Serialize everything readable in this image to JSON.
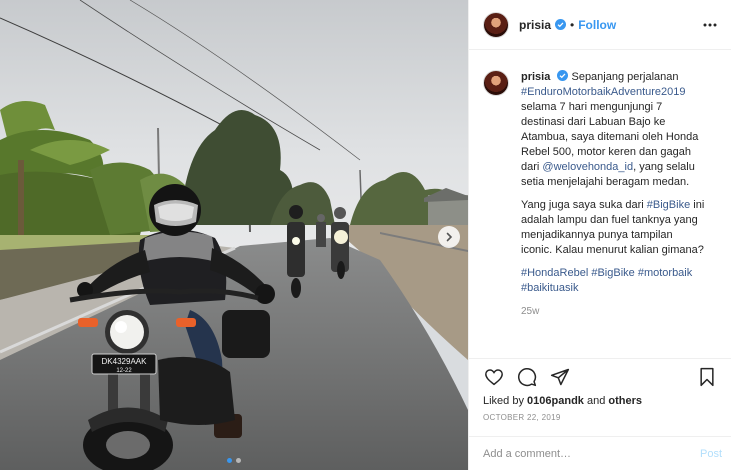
{
  "post": {
    "username": "prisia",
    "separator": "•",
    "follow_label": "Follow",
    "caption": {
      "p1_text_1": "Sepanjang perjalanan",
      "p1_hashtag": "#EnduroMotorbaikAdventure2019",
      "p1_text_2": "selama 7 hari mengunjungi 7 destinasi dari Labuan Bajo ke Atambua, saya ditemani oleh Honda Rebel 500, motor keren dan gagah dari",
      "p1_mention": "@welovehonda_id",
      "p1_text_3": ", yang selalu setia menjelajahi beragam medan.",
      "p2_text_1": "Yang juga saya suka dari",
      "p2_hashtag": "#BigBike",
      "p2_text_2": "ini adalah lampu dan fuel tanknya yang menjadikannya punya tampilan iconic. Kalau menurut kalian gimana?",
      "p3_tag1": "#HondaRebel",
      "p3_tag2": "#BigBike",
      "p3_tag3": "#motorbaik",
      "p3_tag4": "#baikituasik"
    },
    "caption_age": "25w",
    "likes_prefix": "Liked by",
    "likes_user": "0106pandk",
    "likes_and": "and",
    "likes_others": "others",
    "date": "OCTOBER 22, 2019",
    "comment_placeholder": "Add a comment…",
    "post_label": "Post",
    "photo": {
      "plate_line1": "DK4329AAK",
      "plate_line2": "12-22",
      "carousel_count": 2,
      "carousel_active": 1
    }
  },
  "colors": {
    "accent": "#3897f0",
    "text": "#262626",
    "muted": "#8e8e8e",
    "link": "#3a5a8c"
  },
  "icons": [
    "verified-badge-icon",
    "more-options-icon",
    "heart-icon",
    "comment-icon",
    "share-icon",
    "bookmark-icon",
    "add-icon",
    "chevron-right-icon"
  ]
}
